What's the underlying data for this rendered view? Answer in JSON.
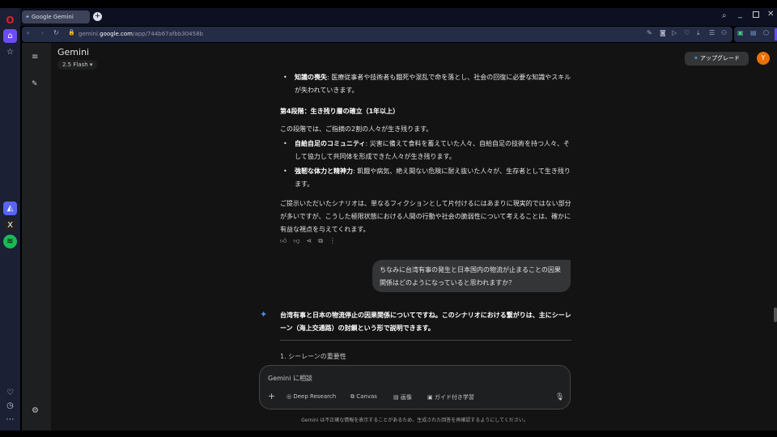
{
  "browser": {
    "tab_title": "Google Gemini",
    "url_domain": "gemini.google.com",
    "url_prefix": "gemini.",
    "url_bold": "google.com",
    "url_path": "/app/744b67afbb30458b"
  },
  "app": {
    "title": "Gemini",
    "model": "2.5 Flash",
    "upgrade": "アップグレード",
    "avatar": "Y"
  },
  "response1": {
    "bullet_top": {
      "bold": "知識の喪失",
      "text": ": 医療従事者や技術者も餓死や混乱で命を落とし、社会の回復に必要な知識やスキルが失われていきます。"
    },
    "heading": "第4段階：生き残り層の確立（1年以上）",
    "intro": "この段階では、ご指摘の2割の人々が生き残ります。",
    "bullets": [
      {
        "bold": "自給自足のコミュニティ",
        "text": ": 災害に備えて食料を蓄えていた人々、自給自足の技術を持つ人々、そして協力して共同体を形成できた人々が生き残ります。"
      },
      {
        "bold": "強靭な体力と精神力",
        "text": ": 飢餓や病気、絶え間ない危険に耐え抜いた人々が、生存者として生き残ります。"
      }
    ],
    "conclusion": "ご提示いただいたシナリオは、単なるフィクションとして片付けるにはあまりに現実的ではない部分が多いですが、こうした極限状態における人間の行動や社会の脆弱性について考えることは、確かに有益な視点を与えてくれます。"
  },
  "user_message": "ちなみに台湾有事の発生と日本国内の物流が止まることの因果関係はどのようになっていると思われますか？",
  "response2": {
    "text_a": "台湾有事と日本の物流停止の因果関係についてですね。このシナリオにおける繋がりは、主に",
    "bold": "シーレーン（海上交通路）の封鎖",
    "text_b": "という形で説明できます。",
    "section": "1. シーレーンの重要性"
  },
  "input": {
    "placeholder": "Gemini に相談",
    "tools": [
      "Deep Research",
      "Canvas",
      "画像",
      "ガイド付き学習"
    ]
  },
  "disclaimer": "Gemini は不正確な情報を表示することがあるため、生成された回答を再確認するようにしてください。"
}
